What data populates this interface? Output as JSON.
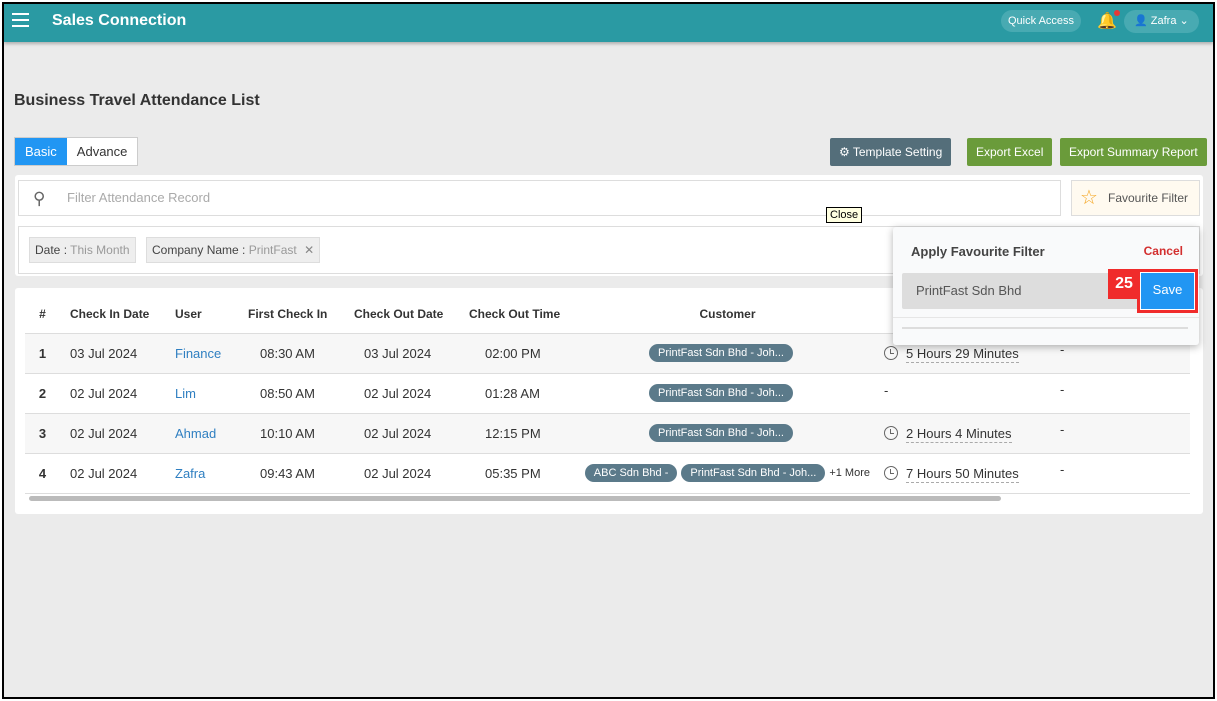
{
  "header": {
    "title": "Sales Connection",
    "quick_access": "Quick Access",
    "user": "Zafra"
  },
  "page": {
    "title": "Business Travel Attendance List"
  },
  "tabs": [
    {
      "label": "Basic"
    },
    {
      "label": "Advance"
    }
  ],
  "toolbar": {
    "template_setting": "Template Setting",
    "export_excel": "Export Excel",
    "export_summary": "Export Summary Report"
  },
  "search": {
    "placeholder": "Filter Attendance Record"
  },
  "favourite_filter": "Favourite Filter",
  "tooltip": "Close",
  "chips": [
    {
      "key": "Date",
      "value": "This Month"
    },
    {
      "key": "Company Name",
      "value": "PrintFast"
    }
  ],
  "popup": {
    "title": "Apply Favourite Filter",
    "cancel": "Cancel",
    "item": "PrintFast Sdn Bhd",
    "save": "Save",
    "badge": "25"
  },
  "table": {
    "columns": [
      "#",
      "Check In Date",
      "User",
      "First Check In",
      "Check Out Date",
      "Check Out Time",
      "Customer"
    ],
    "rows": [
      {
        "n": "1",
        "in_date": "03 Jul 2024",
        "user": "Finance",
        "first_in": "08:30 AM",
        "out_date": "03 Jul 2024",
        "out_time": "02:00 PM",
        "customers": [
          "PrintFast Sdn Bhd - Joh..."
        ],
        "more": "",
        "duration": "5 Hours 29 Minutes",
        "extra": "-"
      },
      {
        "n": "2",
        "in_date": "02 Jul 2024",
        "user": "Lim",
        "first_in": "08:50 AM",
        "out_date": "02 Jul 2024",
        "out_time": "01:28 AM",
        "customers": [
          "PrintFast Sdn Bhd - Joh..."
        ],
        "more": "",
        "duration": "-",
        "extra": "-"
      },
      {
        "n": "3",
        "in_date": "02 Jul 2024",
        "user": "Ahmad",
        "first_in": "10:10 AM",
        "out_date": "02 Jul 2024",
        "out_time": "12:15 PM",
        "customers": [
          "PrintFast Sdn Bhd - Joh..."
        ],
        "more": "",
        "duration": "2 Hours 4 Minutes",
        "extra": "-"
      },
      {
        "n": "4",
        "in_date": "02 Jul 2024",
        "user": "Zafra",
        "first_in": "09:43 AM",
        "out_date": "02 Jul 2024",
        "out_time": "05:35 PM",
        "customers": [
          "ABC Sdn Bhd -",
          "PrintFast Sdn Bhd - Joh..."
        ],
        "more": "+1 More",
        "duration": "7 Hours 50 Minutes",
        "extra": "-"
      }
    ]
  },
  "colors": {
    "topbar": "#2a9aa3",
    "primary": "#2196f3",
    "green": "#6a9b3a",
    "slate": "#5b7a8a",
    "danger": "#d32f2f"
  }
}
